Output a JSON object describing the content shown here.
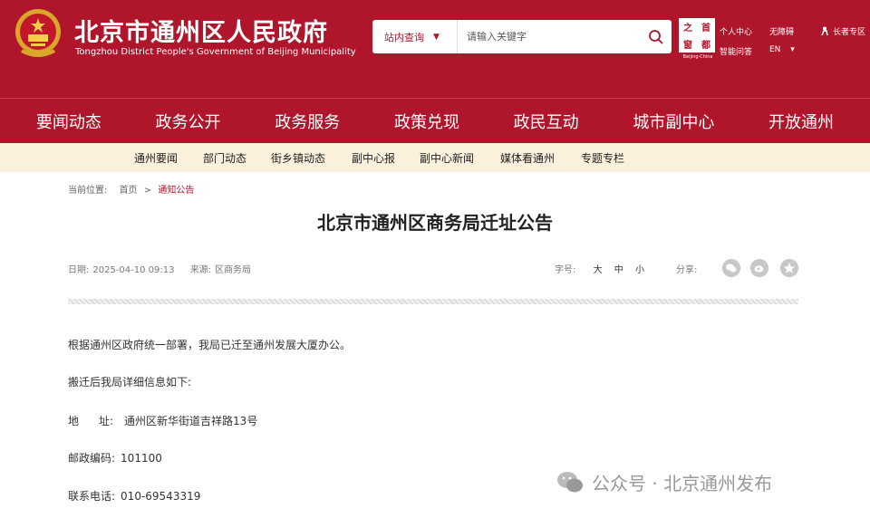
{
  "header": {
    "title": "北京市通州区人民政府",
    "subtitle": "Tongzhou District People's Government of Beijing Municipality",
    "search": {
      "scope_label": "站内查询",
      "placeholder": "请输入关键字"
    },
    "capital_logo": {
      "chars": [
        "首",
        "都",
        "之",
        "窗"
      ],
      "caption": "Beijing·China"
    },
    "utility": {
      "personal": "个人中心",
      "qa": "智能问答",
      "accessibility": "无障碍",
      "language": "EN",
      "language_caret": "▾",
      "elder": "长者专区"
    },
    "accent_color": "#b0162b"
  },
  "main_nav": {
    "items": [
      {
        "label": "要闻动态",
        "active": true
      },
      {
        "label": "政务公开"
      },
      {
        "label": "政务服务"
      },
      {
        "label": "政策兑现"
      },
      {
        "label": "政民互动"
      },
      {
        "label": "城市副中心"
      },
      {
        "label": "开放通州"
      }
    ]
  },
  "sub_nav": {
    "items": [
      {
        "label": "通州要闻"
      },
      {
        "label": "部门动态"
      },
      {
        "label": "街乡镇动态"
      },
      {
        "label": "副中心报"
      },
      {
        "label": "副中心新闻"
      },
      {
        "label": "媒体看通州"
      },
      {
        "label": "专题专栏"
      }
    ]
  },
  "breadcrumb": {
    "prefix": "当前位置:",
    "home": "首页",
    "sep": ">",
    "current": "通知公告"
  },
  "article": {
    "title": "北京市通州区商务局迁址公告",
    "date_label": "日期:",
    "date": "2025-04-10 09:13",
    "source_label": "来源:",
    "source": "区商务局",
    "font_label": "字号:",
    "font_large": "大",
    "font_medium": "中",
    "font_small": "小",
    "share_label": "分享:",
    "paragraphs": {
      "intro": "根据通州区政府统一部署，我局已迁至通州发展大厦办公。",
      "details_intro": "搬迁后我局详细信息如下:",
      "address_label_1": "地",
      "address_label_2": "址:",
      "address": "通州区新华街道吉祥路13号",
      "postcode_label": "邮政编码:",
      "postcode": "101100",
      "phone_label": "联系电话:",
      "phone": "010-69543319"
    }
  },
  "watermark": {
    "text": "公众号 · 北京通州发布"
  }
}
